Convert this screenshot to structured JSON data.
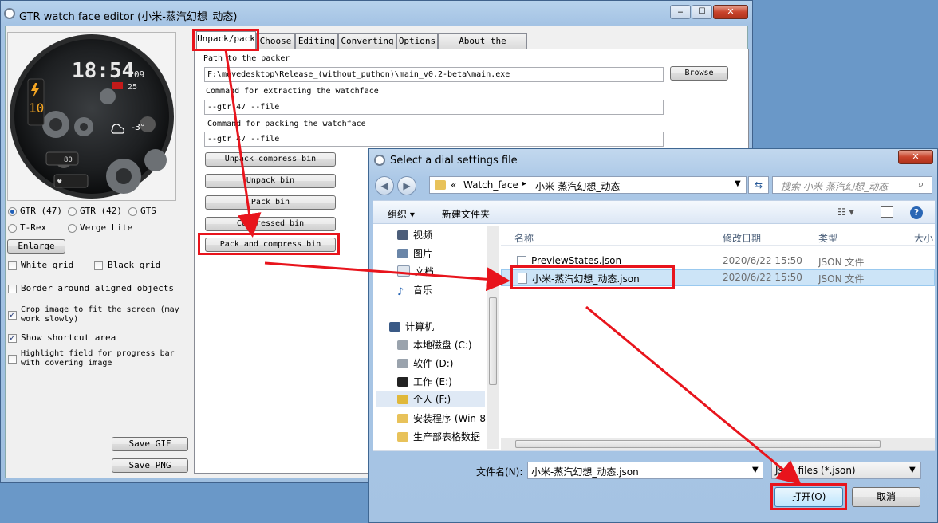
{
  "main_window": {
    "title": "GTR watch face editor (小米-蒸汽幻想_动态)",
    "controls": {
      "minimize": "‒",
      "maximize": "☐",
      "close": "✕"
    }
  },
  "watch_preview": {
    "time": "18:54",
    "seconds": "09",
    "date_day": "25",
    "battery_value": "10",
    "weather": "-3°",
    "steps_value": "80"
  },
  "left_panel": {
    "radios": [
      {
        "label": "GTR (47)",
        "checked": true
      },
      {
        "label": "GTR (42)",
        "checked": false
      },
      {
        "label": "GTS",
        "checked": false
      },
      {
        "label": "T-Rex",
        "checked": false
      },
      {
        "label": "Verge Lite",
        "checked": false
      }
    ],
    "enlarge_label": "Enlarge",
    "checkboxes": [
      {
        "label": "White grid",
        "checked": false
      },
      {
        "label": "Black grid",
        "checked": false
      },
      {
        "label": "Border around aligned objects",
        "checked": false
      },
      {
        "label_1": "Crop image to fit the screen (may",
        "label_2": "work slowly)",
        "checked": true
      },
      {
        "label": "Show shortcut area",
        "checked": true
      },
      {
        "label_1": "Highlight field for progress bar",
        "label_2": "with covering image",
        "checked": false
      }
    ],
    "save_gif_label": "Save GIF",
    "save_png_label": "Save PNG"
  },
  "tabs": [
    {
      "label": "Unpack/pack",
      "active": true
    },
    {
      "label": "Choose",
      "active": false
    },
    {
      "label": "Editing",
      "active": false
    },
    {
      "label": "Converting",
      "active": false
    },
    {
      "label": "Options",
      "active": false
    },
    {
      "label": "About the program",
      "active": false
    }
  ],
  "unpack_tab": {
    "path_label": "Path to the packer",
    "path_value": "F:\\movedesktop\\Release_(without_puthon)\\main_v0.2-beta\\main.exe",
    "browse_label": "Browse",
    "extract_label": "Command for extracting the watchface",
    "extract_value": "--gtr 47 --file",
    "pack_label": "Command for packing the watchface",
    "pack_value": "--gtr 47 --file",
    "buttons": [
      "Unpack compress bin",
      "Unpack bin",
      "Pack bin",
      "Compressed bin",
      "Pack and compress bin"
    ]
  },
  "dialog": {
    "title": "Select a dial settings file",
    "breadcrumb": {
      "root": "«",
      "folder": "Watch_face",
      "sep": "▸",
      "current": "小米-蒸汽幻想_动态"
    },
    "search_placeholder": "搜索 小米-蒸汽幻想_动态",
    "toolbar": {
      "organize": "组织 ▾",
      "new_folder": "新建文件夹"
    },
    "tree": [
      {
        "label": "视频",
        "icon": "video-folder-icon"
      },
      {
        "label": "图片",
        "icon": "picture-folder-icon"
      },
      {
        "label": "文档",
        "icon": "document-folder-icon"
      },
      {
        "label": "音乐",
        "icon": "music-folder-icon"
      },
      {
        "label": "计算机",
        "icon": "computer-icon"
      },
      {
        "label": "本地磁盘 (C:)",
        "icon": "drive-icon"
      },
      {
        "label": "软件 (D:)",
        "icon": "drive-icon"
      },
      {
        "label": "工作 (E:)",
        "icon": "drive-icon"
      },
      {
        "label": "个人 (F:)",
        "icon": "drive-icon"
      },
      {
        "label": "安装程序 (Win-8",
        "icon": "folder-icon"
      },
      {
        "label": "生产部表格数据",
        "icon": "folder-icon"
      }
    ],
    "columns": [
      "名称",
      "修改日期",
      "类型",
      "大小"
    ],
    "files": [
      {
        "name": "PreviewStates.json",
        "date": "2020/6/22 15:50",
        "type": "JSON 文件"
      },
      {
        "name": "小米-蒸汽幻想_动态.json",
        "date": "2020/6/22 15:50",
        "type": "JSON 文件"
      }
    ],
    "filename_label": "文件名(N):",
    "filename_value": "小米-蒸汽幻想_动态.json",
    "filter_value": "Json files (*.json)",
    "open_label": "打开(O)",
    "cancel_label": "取消"
  },
  "colors": {
    "highlight": "#e8141c",
    "selection": "#cce4f7",
    "accent": "#1f5fb8"
  }
}
